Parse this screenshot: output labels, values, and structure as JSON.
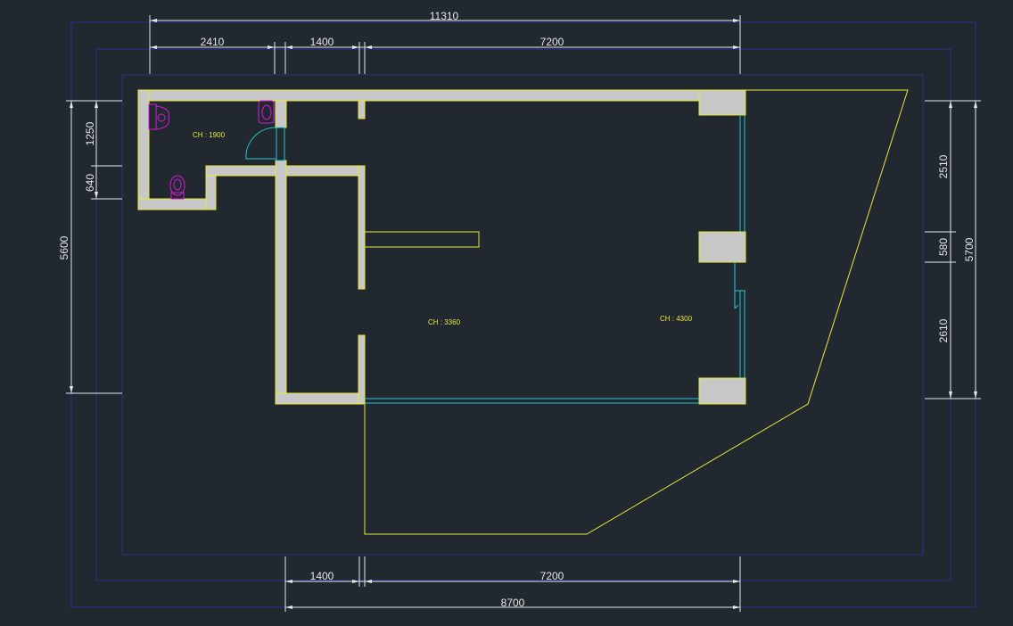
{
  "colors": {
    "background": "#212830",
    "wall_fill": "#c8c8c8",
    "wall_outline": "#e8e83a",
    "dimension": "#e6e6e6",
    "frame": "#2a2f8a",
    "glazing": "#27c7cf",
    "fixtures": "#d61ad6",
    "room_label": "#e8e83a"
  },
  "dimensions": {
    "top_total": "11310",
    "top_left": "2410",
    "top_mid": "1400",
    "top_right": "7200",
    "bottom_mid": "1400",
    "bottom_right": "7200",
    "bottom_total": "8700",
    "left_upper": "1250",
    "left_lower": "640",
    "left_total": "5600",
    "right_upper": "2510",
    "right_mid": "580",
    "right_lower": "2610",
    "right_total": "5700"
  },
  "rooms": {
    "toilet": "CH : 1900",
    "hall": "CH : 3360",
    "main": "CH : 4300"
  }
}
